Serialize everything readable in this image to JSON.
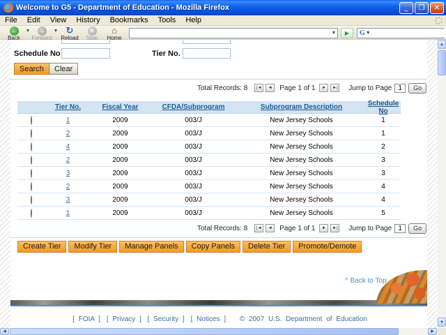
{
  "window": {
    "title": "Welcome to G5 - Department of Education - Mozilla Firefox",
    "menu_items": [
      "File",
      "Edit",
      "View",
      "History",
      "Bookmarks",
      "Tools",
      "Help"
    ],
    "toolbar": {
      "back": "Back",
      "forward": "Forward",
      "reload": "Reload",
      "stop": "Stop",
      "home": "Home",
      "url_value": "",
      "search_value": ""
    }
  },
  "page": {
    "form": {
      "schedule_no_label": "Schedule No",
      "schedule_no_value": "",
      "tier_no_label": "Tier No.",
      "tier_no_value": "",
      "search_button": "Search",
      "clear_button": "Clear"
    },
    "pagination": {
      "total_records": "Total Records: 8",
      "first": "|◄",
      "prev": "◄",
      "page_label": "Page 1 of 1",
      "next": "►",
      "last": "►|",
      "jump_label": "Jump to Page",
      "jump_value": "1",
      "go_button": "Go"
    },
    "table": {
      "headers": [
        "Tier No.",
        "Fiscal Year",
        "CFDA/Subprogram",
        "Subprogram Description",
        "Schedule No"
      ],
      "rows": [
        {
          "tier": "1",
          "fiscal_year": "2009",
          "cfda": "003/J",
          "description": "New Jersey Schools",
          "schedule": "1"
        },
        {
          "tier": "2",
          "fiscal_year": "2009",
          "cfda": "003/J",
          "description": "New Jersey Schools",
          "schedule": "1"
        },
        {
          "tier": "4",
          "fiscal_year": "2009",
          "cfda": "003/J",
          "description": "New Jersey Schools",
          "schedule": "2"
        },
        {
          "tier": "2",
          "fiscal_year": "2009",
          "cfda": "003/J",
          "description": "New Jersey Schools",
          "schedule": "3"
        },
        {
          "tier": "3",
          "fiscal_year": "2009",
          "cfda": "003/J",
          "description": "New Jersey Schools",
          "schedule": "3"
        },
        {
          "tier": "2",
          "fiscal_year": "2009",
          "cfda": "003/J",
          "description": "New Jersey Schools",
          "schedule": "4"
        },
        {
          "tier": "3",
          "fiscal_year": "2009",
          "cfda": "003/J",
          "description": "New Jersey Schools",
          "schedule": "4"
        },
        {
          "tier": "1",
          "fiscal_year": "2009",
          "cfda": "003/J",
          "description": "New Jersey Schools",
          "schedule": "5"
        }
      ]
    },
    "actions": {
      "create": "Create Tier",
      "modify": "Modify Tier",
      "manage": "Manage Panels",
      "copy": "Copy Panels",
      "delete": "Delete Tier",
      "promote": "Promote/Demote"
    },
    "back_to_top": "^ Back to Top",
    "footer": {
      "foia": "[ FOIA ]",
      "privacy": "[ Privacy ]",
      "security": "[ Security ]",
      "notices": "[ Notices ]",
      "copyright": "© 2007 U.S. Department of Education"
    }
  },
  "colors": {
    "title_blue": "#0050dd",
    "accent_orange": "#f6a93c",
    "link_blue": "#1a5a96",
    "table_header_bg": "#d3e4f2"
  }
}
